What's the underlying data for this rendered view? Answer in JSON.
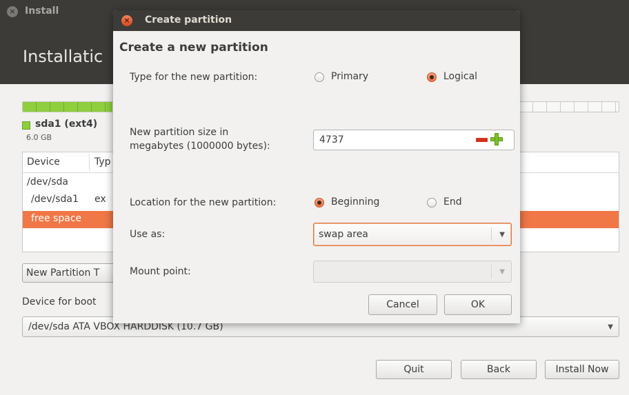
{
  "main": {
    "title": "Install",
    "heading": "Installatic",
    "legend": {
      "name": "sda1 (ext4)",
      "size": "6.0 GB",
      "color": "#8fce3c"
    },
    "disk_usage_fraction": 0.15,
    "table": {
      "headers": [
        "Device",
        "Typ"
      ],
      "rows": [
        {
          "device": "/dev/sda",
          "type": ""
        },
        {
          "device": "/dev/sda1",
          "type": "ex"
        },
        {
          "device": "free space",
          "type": "",
          "selected": true
        }
      ]
    },
    "new_partition_table_button": "New Partition T",
    "boot_label": "Device for boot",
    "boot_device": "/dev/sda   ATA VBOX HARDDISK (10.7 GB)",
    "buttons": {
      "quit": "Quit",
      "back": "Back",
      "install_now": "Install Now"
    },
    "accent_color": "#f07746"
  },
  "dialog": {
    "title": "Create partition",
    "heading": "Create a new partition",
    "type_label": "Type for the new partition:",
    "type_options": {
      "primary": "Primary",
      "logical": "Logical",
      "selected": "logical"
    },
    "size_label_line1": "New partition size in",
    "size_label_line2": "megabytes (1000000 bytes):",
    "size_value": "4737",
    "location_label": "Location for the new partition:",
    "location_options": {
      "beginning": "Beginning",
      "end": "End",
      "selected": "beginning"
    },
    "use_as_label": "Use as:",
    "use_as_value": "swap area",
    "mount_label": "Mount point:",
    "mount_value": "",
    "cancel": "Cancel",
    "ok": "OK"
  }
}
